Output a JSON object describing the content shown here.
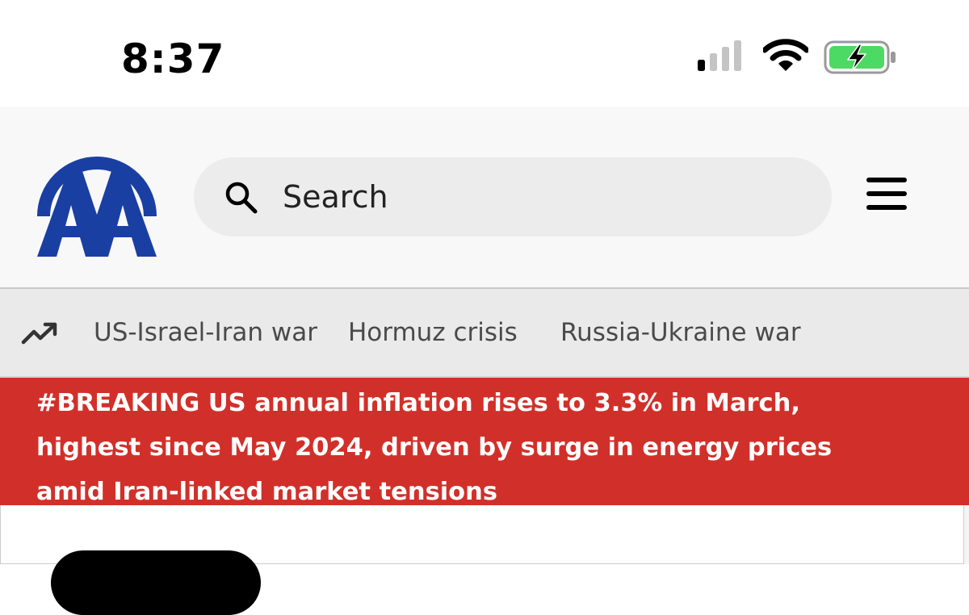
{
  "status_bar": {
    "time": "8:37",
    "icons": [
      "cellular-signal-icon",
      "wifi-icon",
      "battery-charging-icon"
    ],
    "battery_color": "#4cd964"
  },
  "header": {
    "logo": "AA",
    "search": {
      "placeholder": "Search",
      "value": ""
    },
    "menu_icon": "hamburger-menu-icon"
  },
  "trending": {
    "icon": "trending-up-icon",
    "topics": [
      {
        "label": "US-Israel-Iran war"
      },
      {
        "label": "Hormuz crisis"
      },
      {
        "label": "Russia-Ukraine war"
      }
    ]
  },
  "breaking": {
    "text": "#BREAKING US annual inflation rises to 3.3% in March, highest since May 2024, driven by surge in energy prices amid Iran-linked market tensions"
  },
  "colors": {
    "brand_blue": "#1a3fa3",
    "breaking_red": "#d1302a",
    "header_bg": "#f8f8f8",
    "trending_bg": "#eaeaea"
  }
}
